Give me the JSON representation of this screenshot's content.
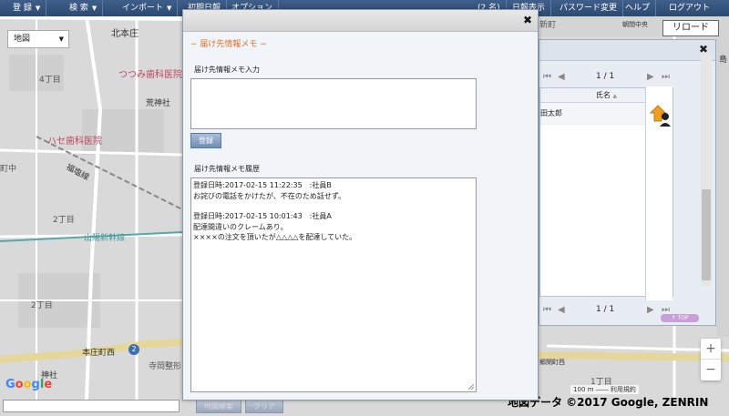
{
  "top_menu": [
    {
      "label": "登 録",
      "caret": "▼"
    },
    {
      "label": "検 索",
      "caret": "▼"
    },
    {
      "label": "インポート",
      "caret": "▼"
    },
    {
      "label": "初期日報",
      "caret": ""
    },
    {
      "label": "オプション",
      "caret": ""
    },
    {
      "label": "(2 名)",
      "caret": ""
    },
    {
      "label": "日報表示",
      "caret": ""
    },
    {
      "label": "パスワード変更",
      "caret": ""
    },
    {
      "label": "ヘルプ",
      "caret": ""
    },
    {
      "label": "ログアウト",
      "caret": ""
    }
  ],
  "map": {
    "type_select": "地図",
    "caret": "▼",
    "labels": {
      "kitahonjo": "北本庄",
      "yonchome": "4丁目",
      "tsutsumi": "つつみ歯科医院",
      "arakami": "荒神社",
      "hase": "ハセ歯科医院",
      "machinaka": "町中",
      "fukusen": "福塩線",
      "nichome": "2丁目",
      "sanyo": "山陽新幹線",
      "nichome2": "2丁目",
      "honjocho": "本庄町西",
      "teraoka": "寺岡整形",
      "jinja": "神社",
      "shingai": "新町",
      "asahi": "朝間中央",
      "shimatsu": "島",
      "icchome": "1丁目",
      "sekimachi": "郷関町西"
    },
    "route_sign": "2",
    "zoom_in": "+",
    "zoom_out": "−",
    "google_logo": "Google",
    "copyright": "地図データ ©2017 Google, ZENRIN",
    "scale": "100 m ⎯⎯⎯⎯ 利用規約"
  },
  "bottom": {
    "search_btn": "地図検索",
    "clear_btn": "クリア"
  },
  "reload_label": "リロード",
  "list_panel": {
    "close": "✖",
    "pager_top": {
      "first": "⏮",
      "prev": "◀",
      "page": "1 / 1",
      "next": "▶",
      "last": "⏭"
    },
    "column_header": "氏名",
    "sort_caret": "▲",
    "row_name": "田太郎",
    "pager_bottom": {
      "first": "⏮",
      "prev": "◀",
      "page": "1 / 1",
      "next": "▶",
      "last": "⏭"
    },
    "top_link": "↑ TOP"
  },
  "dialog": {
    "close": "✖",
    "title": "− 届け先情報メモ −",
    "memo_input_label": "届け先情報メモ入力",
    "memo_input_value": "",
    "register_button": "登録",
    "history_label": "届け先情報メモ履歴",
    "history": [
      {
        "header": "登録日時:2017-02-15 11:22:35　:社員B",
        "lines": [
          "お詫びの電話をかけたが、不在のため話せず。"
        ]
      },
      {
        "header": "登録日時:2017-02-15 10:01:43　:社員A",
        "lines": [
          "配達間違いのクレームあり。",
          "××××の注文を頂いたが△△△△を配達していた。"
        ]
      }
    ]
  }
}
